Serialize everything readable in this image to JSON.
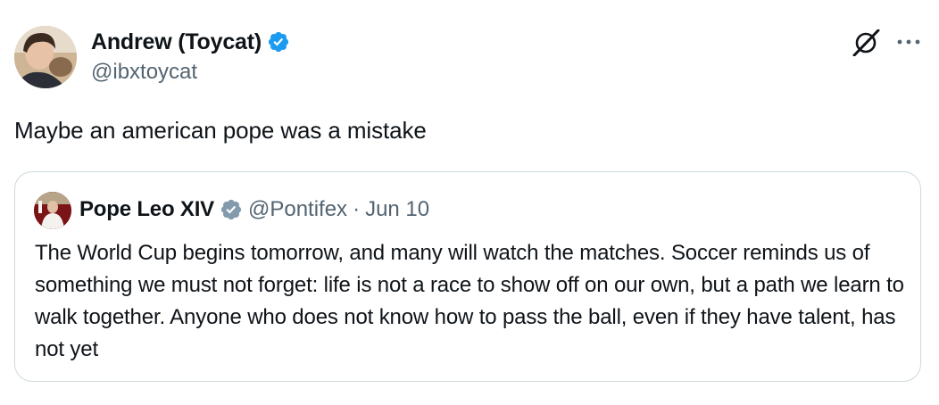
{
  "tweet": {
    "author": {
      "display_name": "Andrew (Toycat)",
      "handle": "@ibxtoycat",
      "verified": true,
      "verified_color": "#1d9bf0"
    },
    "text": "Maybe an american pope was a mistake",
    "actions": {
      "grok_icon": "grok-icon",
      "more_icon": "more-icon"
    }
  },
  "quote": {
    "author": {
      "display_name": "Pope Leo XIV",
      "handle": "@Pontifex",
      "separator": "·",
      "date": "Jun 10",
      "verified": true,
      "verified_color": "#829aab"
    },
    "text": "The World Cup begins tomorrow, and many will watch the matches. Soccer reminds us of something we must not forget: life is not a race to show off on our own, but a path we learn to walk together. Anyone who does not know how to pass the ball, even if they have talent, has not yet"
  },
  "colors": {
    "text_primary": "#0f1419",
    "text_secondary": "#536471",
    "border": "#cfd9de"
  }
}
